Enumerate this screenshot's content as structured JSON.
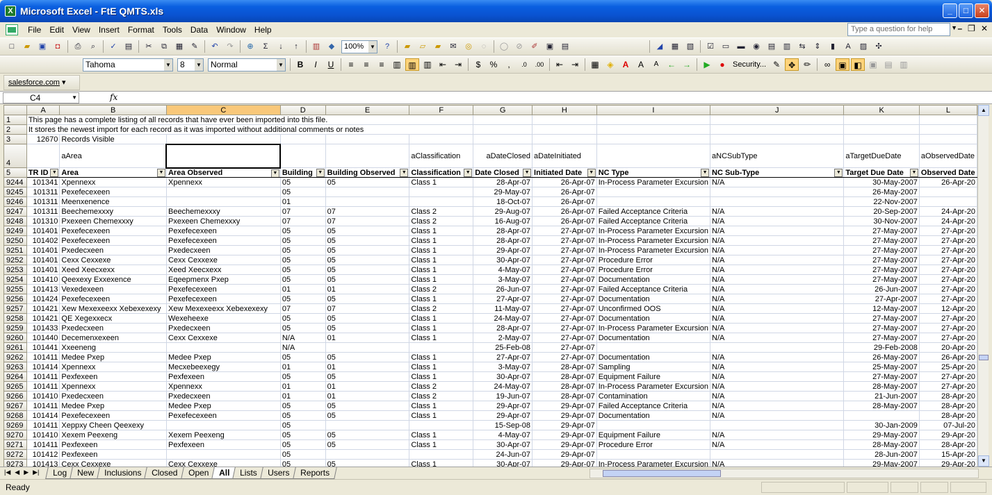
{
  "window": {
    "title": "Microsoft Excel - FtE QMTS.xls",
    "min": "_",
    "max": "□",
    "close": "✕"
  },
  "menu": {
    "items": [
      "File",
      "Edit",
      "View",
      "Insert",
      "Format",
      "Tools",
      "Data",
      "Window",
      "Help"
    ],
    "help_placeholder": "Type a question for help"
  },
  "toolbar": {
    "zoom": "100%",
    "font": "Tahoma",
    "size": "8",
    "style": "Normal",
    "security": "Security..."
  },
  "salesforce": {
    "label": "salesforce.com"
  },
  "formula": {
    "cell_ref": "C4",
    "fx": "fx",
    "content": ""
  },
  "columns": [
    "A",
    "B",
    "C",
    "D",
    "E",
    "F",
    "G",
    "H",
    "I",
    "J",
    "K",
    "L"
  ],
  "info_rows": [
    {
      "row": "1",
      "text": "This page has a complete listing of all records that have ever been imported into this file."
    },
    {
      "row": "2",
      "text": "It stores the newest import for each record as it was imported without additional comments or notes"
    }
  ],
  "row3": {
    "row": "3",
    "count": "12670",
    "label": "Records Visible"
  },
  "row4": {
    "row": "4",
    "cells": [
      "",
      "aArea",
      "",
      "",
      "",
      "aClassification",
      "aDateClosed",
      "aDateInitiated",
      "",
      "aNCSubType",
      "aTargetDueDate",
      "aObservedDate"
    ]
  },
  "row5": {
    "row": "5",
    "headers": [
      "TR ID",
      "Area",
      "Area Observed",
      "Building",
      "Building Observed",
      "Classification",
      "Date Closed",
      "Initiated Date",
      "NC Type",
      "NC Sub-Type",
      "Target Due Date",
      "Observed Date"
    ]
  },
  "data_rows": [
    [
      "9244",
      "101341",
      "Xpennexx",
      "Xpennexx",
      "05",
      "05",
      "Class 1",
      "28-Apr-07",
      "26-Apr-07",
      "In-Process Parameter Excursion",
      "N/A",
      "30-May-2007",
      "26-Apr-20"
    ],
    [
      "9245",
      "101311",
      "Pexefecexeen",
      "",
      "05",
      "",
      "",
      "29-May-07",
      "26-Apr-07",
      "",
      "",
      "26-May-2007",
      ""
    ],
    [
      "9246",
      "101311",
      "Meenxenence",
      "",
      "01",
      "",
      "",
      "18-Oct-07",
      "26-Apr-07",
      "",
      "",
      "22-Nov-2007",
      ""
    ],
    [
      "9247",
      "101311",
      "Beechemexxxy",
      "Beechemexxxy",
      "07",
      "07",
      "Class 2",
      "29-Aug-07",
      "26-Apr-07",
      "Failed Acceptance Criteria",
      "N/A",
      "20-Sep-2007",
      "24-Apr-20"
    ],
    [
      "9248",
      "101310",
      "Pxexeen Chemexxxy",
      "Pxexeen Chemexxxy",
      "07",
      "07",
      "Class 2",
      "16-Aug-07",
      "26-Apr-07",
      "Failed Acceptance Criteria",
      "N/A",
      "30-Nov-2007",
      "24-Apr-20"
    ],
    [
      "9249",
      "101401",
      "Pexefecexeen",
      "Pexefecexeen",
      "05",
      "05",
      "Class 1",
      "28-Apr-07",
      "27-Apr-07",
      "In-Process Parameter Excursion",
      "N/A",
      "27-May-2007",
      "27-Apr-20"
    ],
    [
      "9250",
      "101402",
      "Pexefecexeen",
      "Pexefecexeen",
      "05",
      "05",
      "Class 1",
      "28-Apr-07",
      "27-Apr-07",
      "In-Process Parameter Excursion",
      "N/A",
      "27-May-2007",
      "27-Apr-20"
    ],
    [
      "9251",
      "101401",
      "Pxedecxeen",
      "Pxedecxeen",
      "05",
      "05",
      "Class 1",
      "29-Apr-07",
      "27-Apr-07",
      "In-Process Parameter Excursion",
      "N/A",
      "27-May-2007",
      "27-Apr-20"
    ],
    [
      "9252",
      "101401",
      "Cexx Cexxexe",
      "Cexx Cexxexe",
      "05",
      "05",
      "Class 1",
      "30-Apr-07",
      "27-Apr-07",
      "Procedure Error",
      "N/A",
      "27-May-2007",
      "27-Apr-20"
    ],
    [
      "9253",
      "101401",
      "Xeed Xeecxexx",
      "Xeed Xeecxexx",
      "05",
      "05",
      "Class 1",
      "4-May-07",
      "27-Apr-07",
      "Procedure Error",
      "N/A",
      "27-May-2007",
      "27-Apr-20"
    ],
    [
      "9254",
      "101410",
      "Qeexexy Exxexence",
      "Eqeepmenx Pxep",
      "05",
      "05",
      "Class 1",
      "3-May-07",
      "27-Apr-07",
      "Documentation",
      "N/A",
      "27-May-2007",
      "27-Apr-20"
    ],
    [
      "9255",
      "101413",
      "Vexedexeen",
      "Pexefecexeen",
      "01",
      "01",
      "Class 2",
      "26-Jun-07",
      "27-Apr-07",
      "Failed Acceptance Criteria",
      "N/A",
      "26-Jun-2007",
      "27-Apr-20"
    ],
    [
      "9256",
      "101424",
      "Pexefecexeen",
      "Pexefecexeen",
      "05",
      "05",
      "Class 1",
      "27-Apr-07",
      "27-Apr-07",
      "Documentation",
      "N/A",
      "27-Apr-2007",
      "27-Apr-20"
    ],
    [
      "9257",
      "101421",
      "Xew Mexexeexx Xebexexexy",
      "Xew Mexexeexx Xebexexexy",
      "07",
      "07",
      "Class 2",
      "11-May-07",
      "27-Apr-07",
      "Unconfirmed OOS",
      "N/A",
      "12-May-2007",
      "12-Apr-20"
    ],
    [
      "9258",
      "101421",
      "QE Xegexxecx",
      "Wexeheexe",
      "05",
      "05",
      "Class 1",
      "24-May-07",
      "27-Apr-07",
      "Documentation",
      "N/A",
      "27-May-2007",
      "27-Apr-20"
    ],
    [
      "9259",
      "101433",
      "Pxedecxeen",
      "Pxedecxeen",
      "05",
      "05",
      "Class 1",
      "28-Apr-07",
      "27-Apr-07",
      "In-Process Parameter Excursion",
      "N/A",
      "27-May-2007",
      "27-Apr-20"
    ],
    [
      "9260",
      "101440",
      "Decemenxexeen",
      "Cexx Cexxexe",
      "N/A",
      "01",
      "Class 1",
      "2-May-07",
      "27-Apr-07",
      "Documentation",
      "N/A",
      "27-May-2007",
      "27-Apr-20"
    ],
    [
      "9261",
      "101441",
      "Xxeeneng",
      "",
      "N/A",
      "",
      "",
      "25-Feb-08",
      "27-Apr-07",
      "",
      "",
      "29-Feb-2008",
      "20-Apr-20"
    ],
    [
      "9262",
      "101411",
      "Medee Pxep",
      "Medee Pxep",
      "05",
      "05",
      "Class 1",
      "27-Apr-07",
      "27-Apr-07",
      "Documentation",
      "N/A",
      "26-May-2007",
      "26-Apr-20"
    ],
    [
      "9263",
      "101414",
      "Xpennexx",
      "Mecxebeexegy",
      "01",
      "01",
      "Class 1",
      "3-May-07",
      "28-Apr-07",
      "Sampling",
      "N/A",
      "25-May-2007",
      "25-Apr-20"
    ],
    [
      "9264",
      "101411",
      "Pexfexeen",
      "Pexfexeen",
      "05",
      "05",
      "Class 1",
      "30-Apr-07",
      "28-Apr-07",
      "Equipment Failure",
      "N/A",
      "27-May-2007",
      "27-Apr-20"
    ],
    [
      "9265",
      "101411",
      "Xpennexx",
      "Xpennexx",
      "01",
      "01",
      "Class 2",
      "24-May-07",
      "28-Apr-07",
      "In-Process Parameter Excursion",
      "N/A",
      "28-May-2007",
      "27-Apr-20"
    ],
    [
      "9266",
      "101410",
      "Pxedecxeen",
      "Pxedecxeen",
      "01",
      "01",
      "Class 2",
      "19-Jun-07",
      "28-Apr-07",
      "Contamination",
      "N/A",
      "21-Jun-2007",
      "28-Apr-20"
    ],
    [
      "9267",
      "101411",
      "Medee Pxep",
      "Medee Pxep",
      "05",
      "05",
      "Class 1",
      "29-Apr-07",
      "29-Apr-07",
      "Failed Acceptance Criteria",
      "N/A",
      "28-May-2007",
      "28-Apr-20"
    ],
    [
      "9268",
      "101414",
      "Pexefecexeen",
      "Pexefecexeen",
      "05",
      "05",
      "Class 1",
      "29-Apr-07",
      "29-Apr-07",
      "Documentation",
      "N/A",
      "",
      "28-Apr-20"
    ],
    [
      "9269",
      "101411",
      "Xeppxy Cheen Qeexexy",
      "",
      "05",
      "",
      "",
      "15-Sep-08",
      "29-Apr-07",
      "",
      "",
      "30-Jan-2009",
      "07-Jul-20"
    ],
    [
      "9270",
      "101410",
      "Xexem Peexeng",
      "Xexem Peexeng",
      "05",
      "05",
      "Class 1",
      "4-May-07",
      "29-Apr-07",
      "Equipment Failure",
      "N/A",
      "29-May-2007",
      "29-Apr-20"
    ],
    [
      "9271",
      "101411",
      "Pexfexeen",
      "Pexfexeen",
      "05",
      "05",
      "Class 1",
      "30-Apr-07",
      "29-Apr-07",
      "Procedure Error",
      "N/A",
      "28-May-2007",
      "28-Apr-20"
    ],
    [
      "9272",
      "101412",
      "Pexfexeen",
      "",
      "05",
      "",
      "",
      "24-Jun-07",
      "29-Apr-07",
      "",
      "",
      "28-Jun-2007",
      "15-Apr-20"
    ],
    [
      "9273",
      "101413",
      "Cexx Cexxexe",
      "Cexx Cexxexe",
      "05",
      "05",
      "Class 1",
      "30-Apr-07",
      "29-Apr-07",
      "In-Process Parameter Excursion",
      "N/A",
      "29-May-2007",
      "29-Apr-20"
    ]
  ],
  "tabs": [
    "Log",
    "New",
    "Inclusions",
    "Closed",
    "Open",
    "All",
    "Lists",
    "Users",
    "Reports"
  ],
  "active_tab": "All",
  "status": "Ready"
}
